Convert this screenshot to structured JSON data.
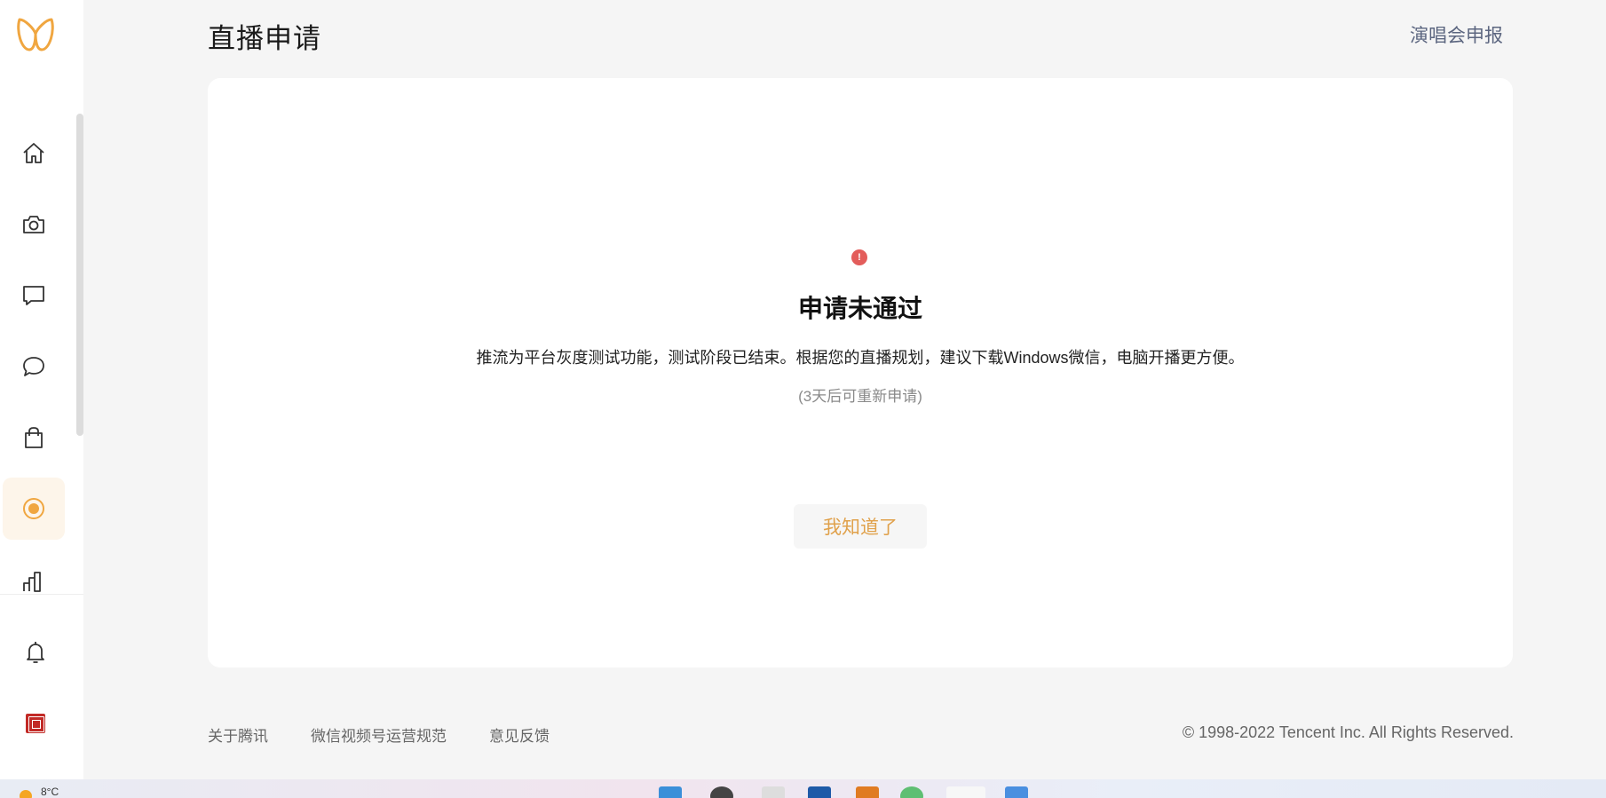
{
  "header": {
    "title": "直播申请",
    "link": "演唱会申报"
  },
  "sidebar": {
    "items": [
      {
        "name": "home",
        "icon": "home-icon"
      },
      {
        "name": "camera",
        "icon": "camera-icon"
      },
      {
        "name": "comment",
        "icon": "comment-icon"
      },
      {
        "name": "message",
        "icon": "message-icon"
      },
      {
        "name": "shop",
        "icon": "shopping-bag-icon"
      },
      {
        "name": "live",
        "icon": "live-icon",
        "active": true
      },
      {
        "name": "stats",
        "icon": "bar-chart-icon"
      }
    ],
    "bottom": [
      {
        "name": "notifications",
        "icon": "bell-icon"
      },
      {
        "name": "avatar",
        "icon": "seal-avatar-icon"
      }
    ]
  },
  "status": {
    "icon": "!",
    "title": "申请未通过",
    "message": "推流为平台灰度测试功能，测试阶段已结束。根据您的直播规划，建议下载Windows微信，电脑开播更方便。",
    "note": "(3天后可重新申请)",
    "button": "我知道了"
  },
  "footer": {
    "links": [
      "关于腾讯",
      "微信视频号运营规范",
      "意见反馈"
    ],
    "copyright": "© 1998-2022 Tencent Inc. All Rights Reserved."
  },
  "taskbar": {
    "temperature": "8°C"
  },
  "colors": {
    "accent": "#e0a14b",
    "error": "#e35d5b",
    "active_bg": "#fdf5ea"
  }
}
